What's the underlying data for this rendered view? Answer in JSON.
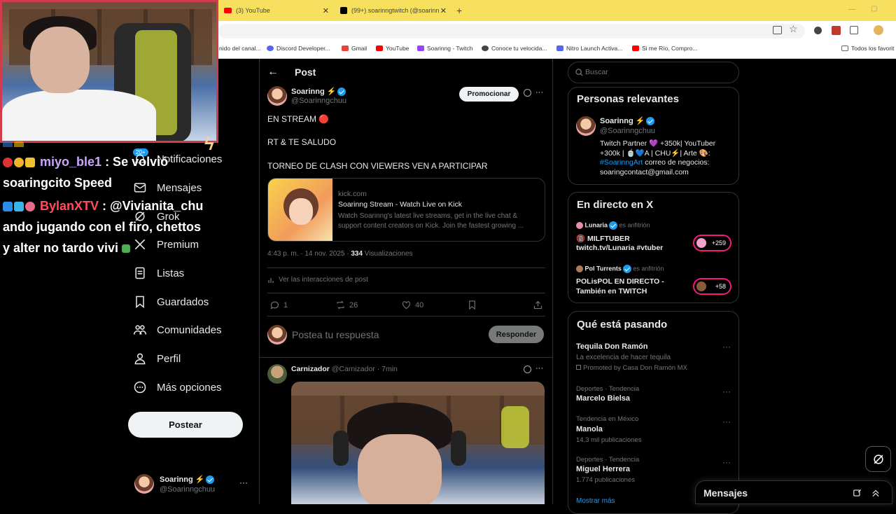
{
  "browser": {
    "tabs": [
      {
        "label": "(3) YouTube"
      },
      {
        "label": "(99+) soarinngtwitch (@soarinn"
      }
    ],
    "new_tab_symbol": "+",
    "bookmarks": [
      {
        "label": "nido del canal...",
        "color": "#888888"
      },
      {
        "label": "Discord Developer...",
        "color": "#5865f2"
      },
      {
        "label": "Gmail",
        "color": "#ea4335"
      },
      {
        "label": "YouTube",
        "color": "#ff0000"
      },
      {
        "label": "Soarinng - Twitch",
        "color": "#9146ff"
      },
      {
        "label": "Conoce tu velocida...",
        "color": "#444444"
      },
      {
        "label": "Nitro Launch Activa...",
        "color": "#5865f2"
      },
      {
        "label": "Si me Río, Compro...",
        "color": "#ff0000"
      }
    ],
    "all_favorites": "Todos los favorit"
  },
  "chat": {
    "line1_user": "miyo_ble1",
    "line1_text": " : Se volvió",
    "line2_text": "soaringcito Speed",
    "line3_user": "BylanXTV",
    "line3_text": " : @Vivianita_chu",
    "line4_text": "ando jugando con el firo, chettos",
    "line5_text": "y alter no tardo vivi"
  },
  "sidebar": {
    "notif_badge": "20+",
    "items": [
      {
        "label": "Notificaciones",
        "icon": "bell-icon"
      },
      {
        "label": "Mensajes",
        "icon": "envelope-icon"
      },
      {
        "label": "Grok",
        "icon": "grok-icon"
      },
      {
        "label": "Premium",
        "icon": "x-logo-icon"
      },
      {
        "label": "Listas",
        "icon": "list-icon"
      },
      {
        "label": "Guardados",
        "icon": "bookmark-icon"
      },
      {
        "label": "Comunidades",
        "icon": "people-icon"
      },
      {
        "label": "Perfil",
        "icon": "person-icon"
      },
      {
        "label": "Más opciones",
        "icon": "more-circle-icon"
      }
    ],
    "post_button": "Postear",
    "account_name": "Soarinng ⚡",
    "account_handle": "@Soarinngchuu",
    "more": "···"
  },
  "post": {
    "header_title": "Post",
    "author_name": "Soarinng ⚡",
    "author_handle": "@Soarinngchuu",
    "promote_button": "Promocionar",
    "line1": "EN STREAM 🔴",
    "line2": "RT & TE SALUDO",
    "line3": "TORNEO DE CLASH CON VIEWERS VEN A PARTICIPAR",
    "card_domain": "kick.com",
    "card_title": "Soarinng Stream - Watch Live on Kick",
    "card_desc": "Watch Soarinng's latest live streams, get in the live chat & support content creators on Kick. Join the fastest growing ...",
    "timestamp": "4:43 p. m. · 14 nov. 2025 · ",
    "views_count": "334",
    "views_label": " Visualizaciones",
    "interactions": "Ver las interacciones de post",
    "replies": "1",
    "reposts": "26",
    "likes": "40",
    "reply_placeholder": "Postea tu respuesta",
    "reply_button": "Responder"
  },
  "reply": {
    "author_name": "Carnizador",
    "author_meta": "@Carnizador · 7min"
  },
  "right": {
    "search_placeholder": "Buscar",
    "relevant_title": "Personas relevantes",
    "relevant_name": "Soarinng ⚡",
    "relevant_handle": "@Soarinngchuu",
    "relevant_bio1": "Twitch Partner 💜 +350k| YouTuber",
    "relevant_bio2": "+300k | 🍵💙A | CHU⚡| Arte 🎨:",
    "relevant_bio3_tag": "#SoarinngArt",
    "relevant_bio3_rest": " correo de negocios:",
    "relevant_bio4": "soaringcontact@gmail.com",
    "live_title": "En directo en X",
    "live": [
      {
        "host": "Lunaria",
        "host_suffix": " es anfitrión",
        "title1": "🔞 MILFTUBER",
        "title2": "twitch.tv/Lunaria #vtuber",
        "count": "+259"
      },
      {
        "host": "Pol Turrents",
        "host_suffix": " es anfitrión",
        "title1": "POLisPOL EN DIRECTO -",
        "title2": "También en TWITCH",
        "count": "+58"
      }
    ],
    "trending_title": "Qué está pasando",
    "trends": [
      {
        "meta": "",
        "name": "Tequila Don Ramón",
        "sub": "La excelencia de hacer tequila",
        "promo": "Promoted by Casa Don Ramón MX"
      },
      {
        "meta": "Deportes · Tendencia",
        "name": "Marcelo Bielsa",
        "sub": ""
      },
      {
        "meta": "Tendencia en México",
        "name": "Manola",
        "sub": "14,3 mil publicaciones"
      },
      {
        "meta": "Deportes · Tendencia",
        "name": "Miguel Herrera",
        "sub": "1.774 publicaciones"
      }
    ],
    "show_more": "Mostrar más",
    "messages": "Mensajes"
  },
  "colors": {
    "tab_bar": "#f6e05e",
    "x_blue": "#1d9bf0",
    "live_pink": "#f91880",
    "webcam_border": "#d23b4b"
  }
}
